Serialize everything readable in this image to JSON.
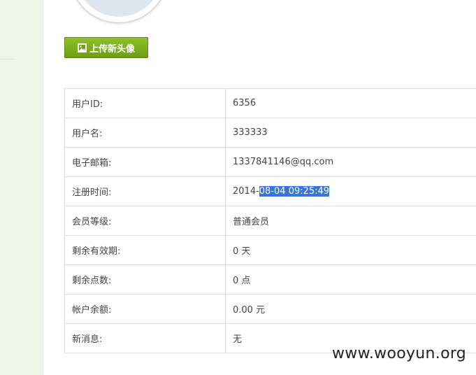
{
  "profile": {
    "upload_button_label": "上传新头像",
    "upload_icon": "image-icon"
  },
  "info_rows": [
    {
      "label": "用户ID:",
      "value": "6356"
    },
    {
      "label": "用户名:",
      "value": "333333"
    },
    {
      "label": "电子邮箱:",
      "value": "1337841146@qq.com"
    },
    {
      "label": "注册时间:",
      "value_prefix": "2014-",
      "value_selected": "08-04 09:25:49"
    },
    {
      "label": "会员等级:",
      "value": "普通会员"
    },
    {
      "label": "剩余有效期:",
      "value": "0 天"
    },
    {
      "label": "剩余点数:",
      "value": "0 点"
    },
    {
      "label": "帐户余额:",
      "value": "0.00 元"
    },
    {
      "label": "新消息:",
      "value": "无"
    }
  ],
  "watermark": "www.wooyun.org",
  "colors": {
    "accent_green": "#7aab1c",
    "sidebar_bg": "#eef5e6",
    "selection_blue": "#3875d7"
  }
}
